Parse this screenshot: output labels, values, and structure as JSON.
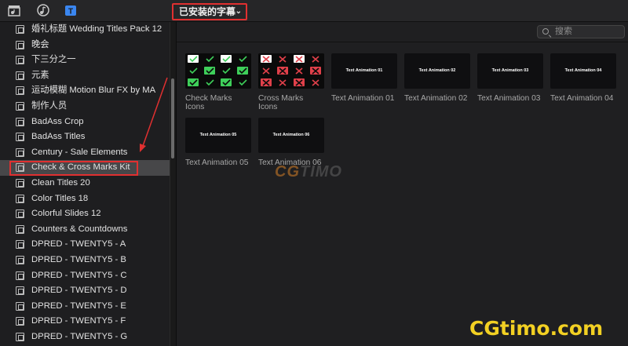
{
  "toolbar": {
    "icons": [
      "clapperboard-music-icon",
      "music-note-icon",
      "titles-icon"
    ],
    "dropdown_label": "已安装的字幕"
  },
  "search": {
    "placeholder": "搜索"
  },
  "sidebar": {
    "items": [
      {
        "label": "婚礼标题 Wedding Titles Pack 12"
      },
      {
        "label": "晚会"
      },
      {
        "label": "下三分之一"
      },
      {
        "label": "元素"
      },
      {
        "label": "运动模糊 Motion Blur FX by MA"
      },
      {
        "label": "制作人员"
      },
      {
        "label": "BadAss Crop"
      },
      {
        "label": "BadAss Titles"
      },
      {
        "label": "Century - Sale Elements"
      },
      {
        "label": "Check & Cross Marks Kit",
        "selected": true
      },
      {
        "label": "Clean Titles 20"
      },
      {
        "label": "Color Titles 18"
      },
      {
        "label": "Colorful Slides 12"
      },
      {
        "label": "Counters & Countdowns"
      },
      {
        "label": "DPRED - TWENTY5 - A"
      },
      {
        "label": "DPRED - TWENTY5 - B"
      },
      {
        "label": "DPRED - TWENTY5 - C"
      },
      {
        "label": "DPRED - TWENTY5 - D"
      },
      {
        "label": "DPRED - TWENTY5 - E"
      },
      {
        "label": "DPRED - TWENTY5 - F"
      },
      {
        "label": "DPRED - TWENTY5 - G"
      }
    ]
  },
  "tiles": [
    {
      "label": "Check Marks Icons",
      "thumb_text": ""
    },
    {
      "label": "Cross Marks Icons",
      "thumb_text": ""
    },
    {
      "label": "Text Animation 01",
      "thumb_text": "Text Animation 01"
    },
    {
      "label": "Text Animation 02",
      "thumb_text": "Text Animation 02"
    },
    {
      "label": "Text Animation 03",
      "thumb_text": "Text Animation 03"
    },
    {
      "label": "Text Animation 04",
      "thumb_text": "Text Animation 04"
    },
    {
      "label": "Text Animation 05",
      "thumb_text": "Text Animation 05"
    },
    {
      "label": "Text Animation 06",
      "thumb_text": "Text Animation 06"
    }
  ],
  "watermark": {
    "cg": "CG",
    "timo": "TIMO"
  },
  "brand": "CGtimo.com",
  "colors": {
    "accent_red": "#e03030",
    "check_green": "#3ecf5a",
    "cross_red": "#e0404a",
    "brand_yellow": "#f2d023"
  }
}
